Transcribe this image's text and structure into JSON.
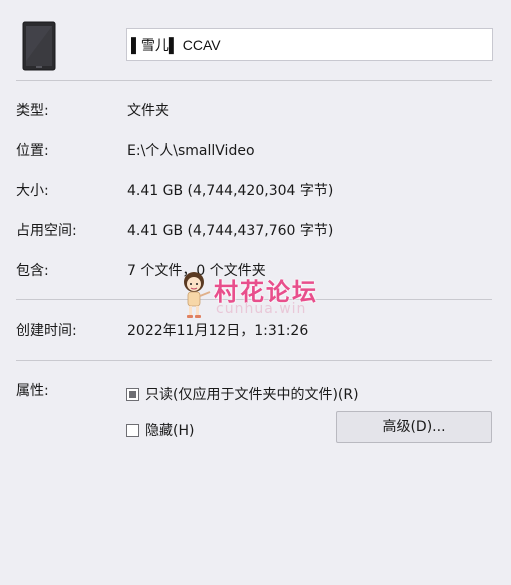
{
  "name_field": {
    "value": "▌雪儿▌ CCAV"
  },
  "rows": {
    "type": {
      "label": "类型:",
      "value": "文件夹"
    },
    "location": {
      "label": "位置:",
      "value": "E:\\个人\\smallVideo"
    },
    "size": {
      "label": "大小:",
      "value": "4.41 GB (4,744,420,304 字节)"
    },
    "size_on_disk": {
      "label": "占用空间:",
      "value": "4.41 GB (4,744,437,760 字节)"
    },
    "contains": {
      "label": "包含:",
      "value": "7 个文件，0 个文件夹"
    },
    "created": {
      "label": "创建时间:",
      "value": "2022年11月12日，1:31:26"
    }
  },
  "attributes": {
    "label": "属性:",
    "readonly": {
      "label": "只读(仅应用于文件夹中的文件)(R)",
      "state": "indeterminate"
    },
    "hidden": {
      "label": "隐藏(H)",
      "state": "unchecked"
    },
    "advanced_button": "高级(D)..."
  },
  "watermark": {
    "text": "村花论坛",
    "domain": "cunhua.win",
    "color": "#e84f8c"
  },
  "icons": {
    "folder": "dark-folder-icon"
  }
}
